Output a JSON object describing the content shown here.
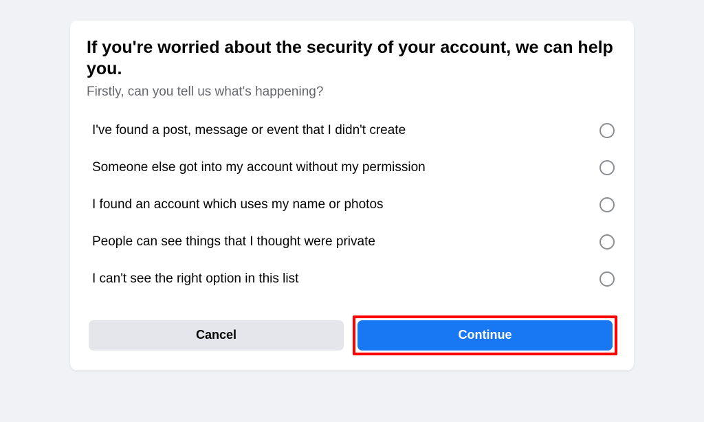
{
  "dialog": {
    "title": "If you're worried about the security of your account, we can help you.",
    "subtitle": "Firstly, can you tell us what's happening?",
    "options": [
      {
        "label": "I've found a post, message or event that I didn't create"
      },
      {
        "label": "Someone else got into my account without my permission"
      },
      {
        "label": "I found an account which uses my name or photos"
      },
      {
        "label": "People can see things that I thought were private"
      },
      {
        "label": "I can't see the right option in this list"
      }
    ],
    "cancel_label": "Cancel",
    "continue_label": "Continue"
  }
}
